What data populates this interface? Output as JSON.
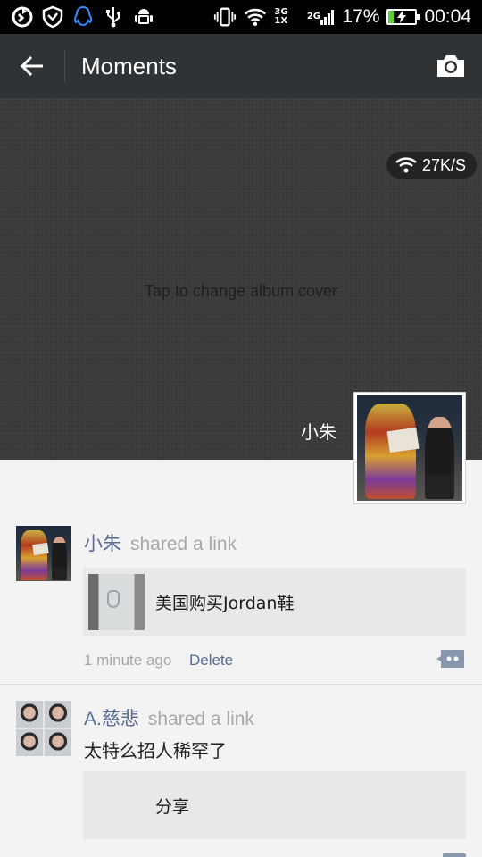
{
  "status_bar": {
    "icons_left": [
      "sync-icon",
      "shield-icon",
      "qq-penguin-icon",
      "usb-icon",
      "android-debug-icon"
    ],
    "icons_right": [
      "vibrate-icon",
      "wifi-icon",
      "signal-3g-icon",
      "signal-2g-icon",
      "battery-charging-icon"
    ],
    "network_3g": "3G",
    "network_1x": "1X",
    "network_2g": "2G",
    "battery_percent": "17%",
    "battery_level": 0.17,
    "time": "00:04"
  },
  "header": {
    "back_icon": "arrow-left-icon",
    "title": "Moments",
    "camera_icon": "camera-icon"
  },
  "cover": {
    "speed": "27K/S",
    "hint": "Tap to change album cover",
    "user_name": "小朱"
  },
  "feed": [
    {
      "nickname": "小朱",
      "action": "shared a link",
      "link_title": "美国购买Jordan鞋",
      "time": "1 minute ago",
      "delete_label": "Delete"
    },
    {
      "nickname": "A.慈悲",
      "action": "shared a link",
      "text": "太特么招人稀罕了",
      "link_title": "分享"
    }
  ],
  "colors": {
    "status_bg": "#000000",
    "title_bg": "#2f3336",
    "nickname": "#576b95",
    "muted": "#a7a7a7",
    "battery_fill": "#5ccf3a"
  }
}
